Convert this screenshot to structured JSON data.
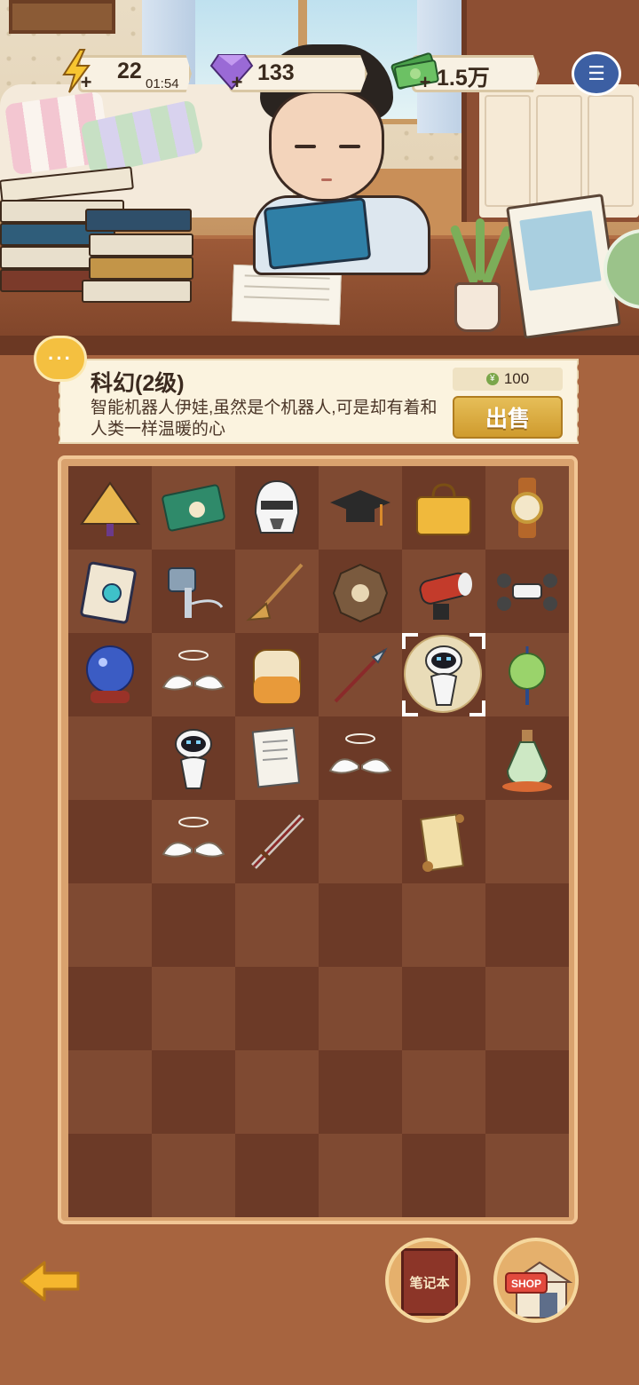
{
  "hud": {
    "energy": {
      "value": "22",
      "timer": "01:54",
      "icon": "lightning-icon"
    },
    "gems": {
      "value": "133",
      "icon": "gem-icon"
    },
    "cash": {
      "value": "1.5万",
      "icon": "cash-icon"
    },
    "help_icon": "notes-help-icon"
  },
  "item_info": {
    "title": "科幻(2级)",
    "description": "智能机器人伊娃,虽然是个机器人,可是却有着和人类一样温暖的心",
    "price": "100",
    "price_icon_label": "¥",
    "sell_label": "出售",
    "bubble_label": "···"
  },
  "grid": {
    "columns": 6,
    "rows": 9,
    "selected_index": 16,
    "items": [
      "fan-item",
      "banknote-item",
      "stormtrooper-helmet-item",
      "graduation-cap-item",
      "briefcase-item",
      "wristwatch-item",
      "spellbook-item",
      "hammer-item",
      "broom-item",
      "bagua-mirror-item",
      "telescope-item",
      "drone-item",
      "crystal-ball-item",
      "angel-wings-item",
      "backpack-item",
      "spear-item",
      "eve-robot-item",
      "jade-pendant-item",
      "",
      "eve-robot-item",
      "exam-paper-item",
      "angel-wings-item",
      "",
      "potion-bottle-item",
      "",
      "angel-wings-item",
      "sword-item",
      "",
      "scroll-item",
      "",
      "",
      "",
      "",
      "",
      "",
      "",
      "",
      "",
      "",
      "",
      "",
      "",
      "",
      "",
      "",
      "",
      "",
      "",
      "",
      "",
      "",
      "",
      "",
      ""
    ]
  },
  "bottom": {
    "notebook_label": "笔记本",
    "shop_label": "SHOP"
  }
}
